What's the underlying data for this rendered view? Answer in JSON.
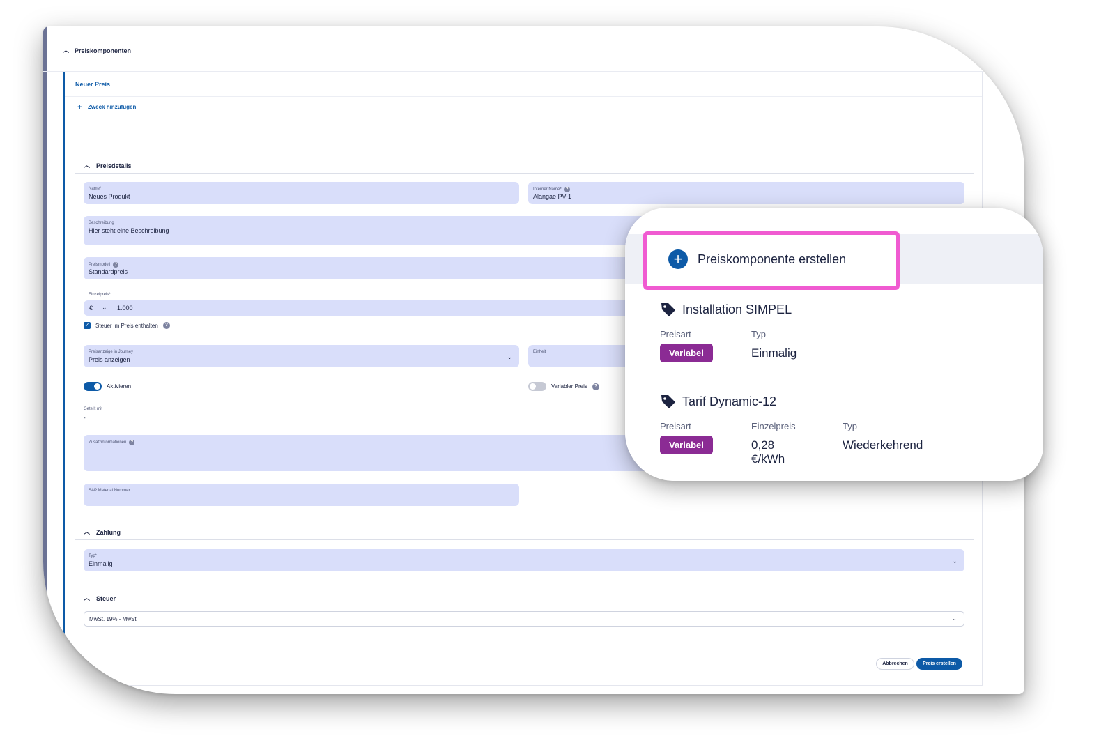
{
  "form": {
    "top_section": "Preiskomponenten",
    "panel_title": "Neuer Preis",
    "add_purpose": "Zweck hinzufügen",
    "sections": {
      "preisdetails": "Preisdetails",
      "zahlung": "Zahlung",
      "steuer": "Steuer"
    },
    "fields": {
      "name": {
        "label": "Name*",
        "value": "Neues Produkt"
      },
      "internal_name": {
        "label": "Interner Name*",
        "value": "Alangae PV-1"
      },
      "description": {
        "label": "Beschreibung",
        "value": "Hier steht eine Beschreibung"
      },
      "price_model": {
        "label": "Preismodell",
        "value": "Standardpreis"
      },
      "unit_price": {
        "label": "Einzelpreis*",
        "currency": "€",
        "value": "1.000"
      },
      "tax_included": "Steuer im Preis enthalten",
      "price_display": {
        "label": "Preisanzeige in Journey",
        "value": "Preis anzeigen"
      },
      "unit": {
        "label": "Einheit"
      },
      "activate": "Aktivieren",
      "variable_price": "Variabler Preis",
      "shared_with": {
        "label": "Geteilt mit",
        "value": "-"
      },
      "additional_info": {
        "label": "Zusatzinformationen"
      },
      "sap_number": {
        "label": "SAP Material Nummer"
      },
      "type": {
        "label": "Typ*",
        "value": "Einmalig"
      },
      "tax": {
        "value": "MwSt. 19% - MwSt"
      }
    },
    "buttons": {
      "cancel": "Abbrechen",
      "create": "Preis erstellen"
    }
  },
  "zoom": {
    "create_component": "Preiskomponente erstellen",
    "highlight_color": "#f05bd1",
    "components": [
      {
        "name": "Installation SIMPEL",
        "price_type_label": "Preisart",
        "price_type": "Variabel",
        "type_label": "Typ",
        "type": "Einmalig"
      },
      {
        "name": "Tarif Dynamic-12",
        "price_type_label": "Preisart",
        "price_type": "Variabel",
        "unit_price_label": "Einzelpreis",
        "unit_price": "0,28 €/kWh",
        "type_label": "Typ",
        "type": "Wiederkehrend"
      }
    ]
  },
  "colors": {
    "primary": "#0d5aa7",
    "field_bg": "#d9defa",
    "badge": "#8b2b94"
  }
}
